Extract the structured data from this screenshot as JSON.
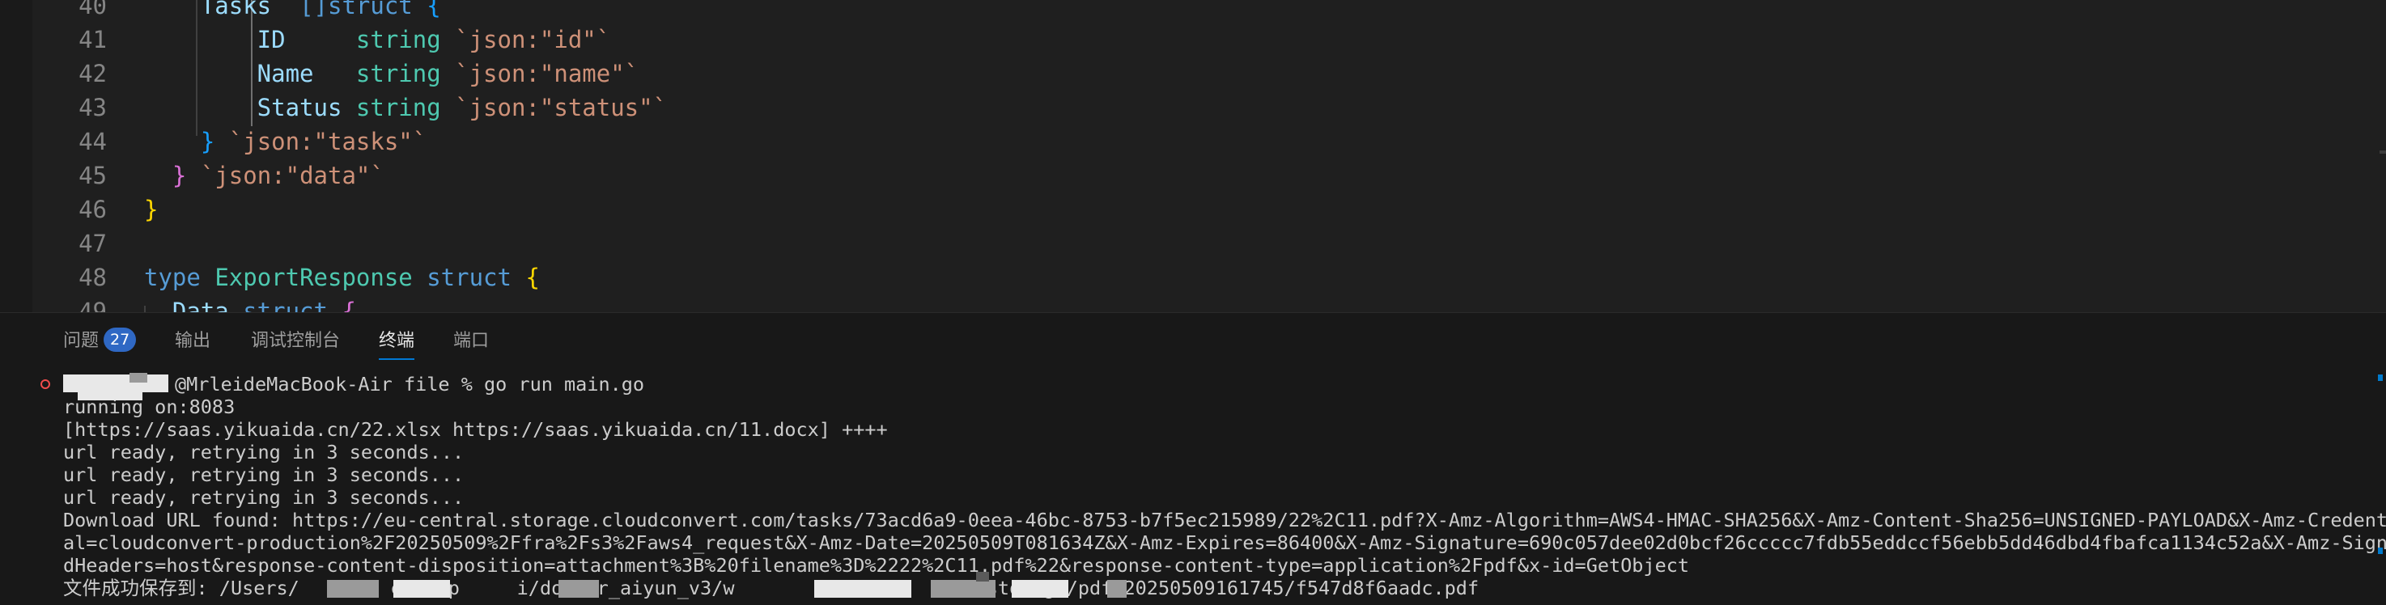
{
  "editor": {
    "lines": [
      {
        "num": "40",
        "parts": [
          {
            "t": "    Tasks  ",
            "c": "fld"
          },
          {
            "t": "[]",
            "c": "kw"
          },
          {
            "t": "struct",
            "c": "kw"
          },
          {
            "t": " {",
            "c": "b3"
          }
        ]
      },
      {
        "num": "41",
        "parts": [
          {
            "t": "        ID     ",
            "c": "fld"
          },
          {
            "t": "string",
            "c": "ty"
          },
          {
            "t": " ",
            "c": ""
          },
          {
            "t": "`json:\"id\"`",
            "c": "str"
          }
        ]
      },
      {
        "num": "42",
        "parts": [
          {
            "t": "        Name   ",
            "c": "fld"
          },
          {
            "t": "string",
            "c": "ty"
          },
          {
            "t": " ",
            "c": ""
          },
          {
            "t": "`json:\"name\"`",
            "c": "str"
          }
        ]
      },
      {
        "num": "43",
        "parts": [
          {
            "t": "        Status ",
            "c": "fld"
          },
          {
            "t": "string",
            "c": "ty"
          },
          {
            "t": " ",
            "c": ""
          },
          {
            "t": "`json:\"status\"`",
            "c": "str"
          }
        ]
      },
      {
        "num": "44",
        "parts": [
          {
            "t": "    ",
            "c": ""
          },
          {
            "t": "}",
            "c": "b3"
          },
          {
            "t": " ",
            "c": ""
          },
          {
            "t": "`json:\"tasks\"`",
            "c": "str"
          }
        ]
      },
      {
        "num": "45",
        "parts": [
          {
            "t": "  ",
            "c": ""
          },
          {
            "t": "}",
            "c": "b2"
          },
          {
            "t": " ",
            "c": ""
          },
          {
            "t": "`json:\"data\"`",
            "c": "str"
          }
        ]
      },
      {
        "num": "46",
        "parts": [
          {
            "t": "}",
            "c": "b1"
          }
        ]
      },
      {
        "num": "47",
        "parts": []
      },
      {
        "num": "48",
        "parts": [
          {
            "t": "type",
            "c": "kw"
          },
          {
            "t": " ",
            "c": ""
          },
          {
            "t": "ExportResponse",
            "c": "ty"
          },
          {
            "t": " ",
            "c": ""
          },
          {
            "t": "struct",
            "c": "kw"
          },
          {
            "t": " {",
            "c": "b1"
          }
        ]
      },
      {
        "num": "49",
        "parts": [
          {
            "t": "  Data ",
            "c": "fld"
          },
          {
            "t": "struct",
            "c": "kw"
          },
          {
            "t": " {",
            "c": "b2"
          }
        ]
      }
    ]
  },
  "panel": {
    "tabs": [
      {
        "label": "问题",
        "badge": "27"
      },
      {
        "label": "输出"
      },
      {
        "label": "调试控制台"
      },
      {
        "label": "终端"
      },
      {
        "label": "端口"
      }
    ]
  },
  "terminal": {
    "lines": [
      "@MrleideMacBook-Air file % go run main.go",
      "running on:8083",
      "[https://saas.yikuaida.cn/22.xlsx https://saas.yikuaida.cn/11.docx] ++++",
      "url ready, retrying in 3 seconds...",
      "url ready, retrying in 3 seconds...",
      "url ready, retrying in 3 seconds...",
      "Download URL found: https://eu-central.storage.cloudconvert.com/tasks/73acd6a9-0eea-46bc-8753-b7f5ec215989/22%2C11.pdf?X-Amz-Algorithm=AWS4-HMAC-SHA256&X-Amz-Content-Sha256=UNSIGNED-PAYLOAD&X-Amz-Credenti",
      "al=cloudconvert-production%2F20250509%2Ffra%2Fs3%2Faws4_request&X-Amz-Date=20250509T081634Z&X-Amz-Expires=86400&X-Amz-Signature=690c057dee02d0bcf26ccccc7fdb55eddccf56ebb5dd46dbd4fbafca1134c52a&X-Amz-Signe",
      "dHeaders=host&response-content-disposition=attachment%3B%20filename%3D%2222%2C11.pdf%22&response-content-type=application%2Fpdf&x-id=GetObject",
      "文件成功保存到: /Users/        esktop     i/docker_aiyun_v3/w                    c/storage/pdf/20250509161745/f547d8f6aadc.pdf"
    ]
  }
}
